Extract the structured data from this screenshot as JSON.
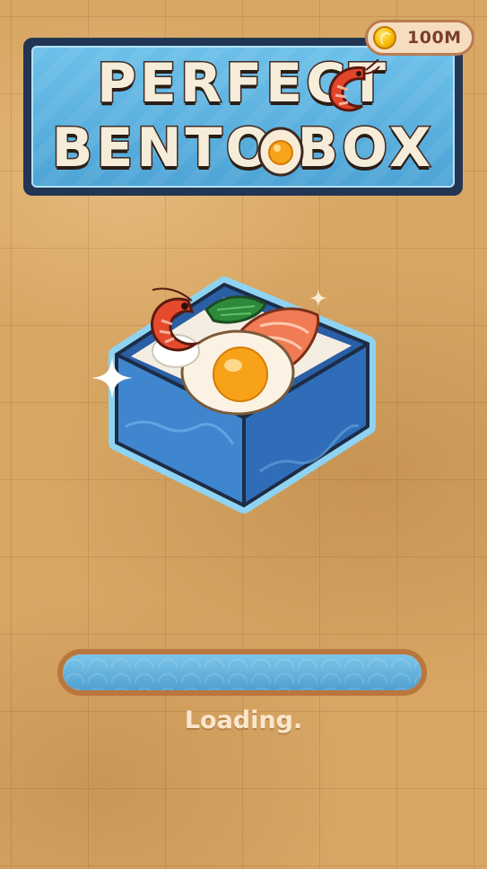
{
  "hud": {
    "coin_amount": "100M"
  },
  "title": {
    "line1": "PERFECT",
    "line2": "BENTO BOX"
  },
  "loading": {
    "label": "Loading.",
    "progress": 1.0
  },
  "colors": {
    "background": "#d9a764",
    "title_panel_border": "#223654",
    "title_panel_fill": "#5db4e1",
    "title_text": "#f6ecda",
    "bento_box": "#3a7fc8",
    "loading_frame": "#b9773e",
    "loading_fill": "#5fb0dd",
    "loading_text": "#fbe6cc"
  },
  "icons": {
    "coin": "coin-icon",
    "shrimp": "shrimp-icon",
    "egg": "fried-egg-icon",
    "sparkle": "sparkle-icon"
  }
}
